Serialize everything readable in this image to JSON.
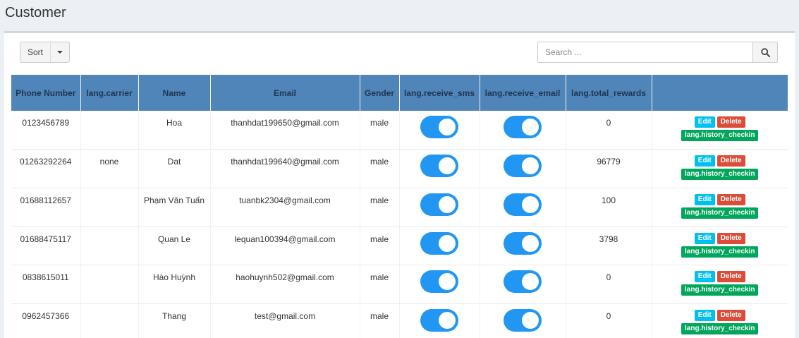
{
  "page": {
    "title": "Customer"
  },
  "toolbar": {
    "sort_label": "Sort",
    "search_placeholder": "Search ..."
  },
  "table": {
    "columns": [
      "Phone Number",
      "lang.carrier",
      "Name",
      "Email",
      "Gender",
      "lang.receive_sms",
      "lang.receive_email",
      "lang.total_rewards",
      ""
    ],
    "rows": [
      {
        "phone": "0123456789",
        "carrier": "",
        "name": "Hoa",
        "email": "thanhdat199650@gmail.com",
        "gender": "male",
        "receive_sms": true,
        "receive_email": true,
        "total_rewards": "0"
      },
      {
        "phone": "01263292264",
        "carrier": "none",
        "name": "Dat",
        "email": "thanhdat199640@gmail.com",
        "gender": "male",
        "receive_sms": true,
        "receive_email": true,
        "total_rewards": "96779"
      },
      {
        "phone": "01688112657",
        "carrier": "",
        "name": "Phạm Văn Tuấn",
        "email": "tuanbk2304@gmail.com",
        "gender": "male",
        "receive_sms": true,
        "receive_email": true,
        "total_rewards": "100"
      },
      {
        "phone": "01688475117",
        "carrier": "",
        "name": "Quan Le",
        "email": "lequan100394@gmail.com",
        "gender": "male",
        "receive_sms": true,
        "receive_email": true,
        "total_rewards": "3798"
      },
      {
        "phone": "0838615011",
        "carrier": "",
        "name": "Hào Huỳnh",
        "email": "haohuynh502@gmail.com",
        "gender": "male",
        "receive_sms": true,
        "receive_email": true,
        "total_rewards": "0"
      },
      {
        "phone": "0962457366",
        "carrier": "",
        "name": "Thang",
        "email": "test@gmail.com",
        "gender": "male",
        "receive_sms": true,
        "receive_email": true,
        "total_rewards": "0"
      }
    ],
    "actions": {
      "edit": "Edit",
      "delete": "Delete",
      "history": "lang.history_checkin"
    }
  },
  "colors": {
    "header_bg": "#4f85b8",
    "toggle_on": "#2196f3",
    "edit": "#00c0ef",
    "delete": "#dd4b39",
    "history": "#00a65a"
  },
  "icons": {
    "search": "search-icon",
    "sort_caret": "caret-down-icon"
  }
}
